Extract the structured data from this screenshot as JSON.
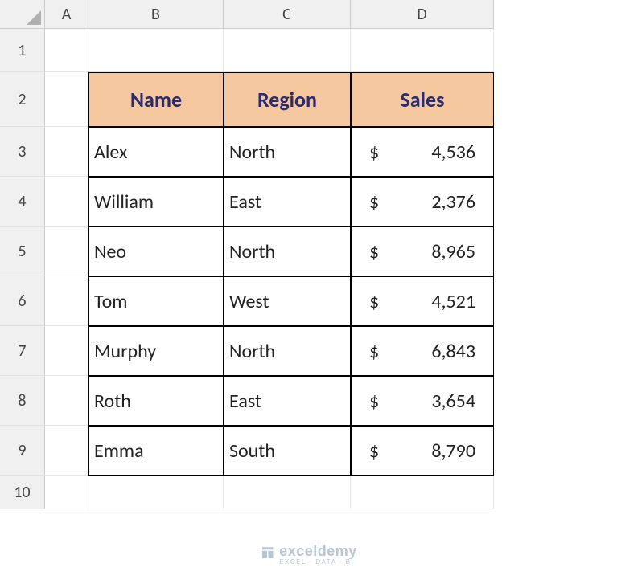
{
  "columns": [
    "A",
    "B",
    "C",
    "D"
  ],
  "rows": [
    "1",
    "2",
    "3",
    "4",
    "5",
    "6",
    "7",
    "8",
    "9",
    "10"
  ],
  "table": {
    "headers": {
      "name": "Name",
      "region": "Region",
      "sales": "Sales"
    },
    "data": [
      {
        "name": "Alex",
        "region": "North",
        "sales_currency": "$",
        "sales_amount": "4,536"
      },
      {
        "name": "William",
        "region": "East",
        "sales_currency": "$",
        "sales_amount": "2,376"
      },
      {
        "name": "Neo",
        "region": "North",
        "sales_currency": "$",
        "sales_amount": "8,965"
      },
      {
        "name": "Tom",
        "region": "West",
        "sales_currency": "$",
        "sales_amount": "4,521"
      },
      {
        "name": "Murphy",
        "region": "North",
        "sales_currency": "$",
        "sales_amount": "6,843"
      },
      {
        "name": "Roth",
        "region": "East",
        "sales_currency": "$",
        "sales_amount": "3,654"
      },
      {
        "name": "Emma",
        "region": "South",
        "sales_currency": "$",
        "sales_amount": "8,790"
      }
    ]
  },
  "watermark": {
    "main": "exceldemy",
    "sub": "EXCEL · DATA · BI"
  },
  "chart_data": {
    "type": "table",
    "columns": [
      "Name",
      "Region",
      "Sales"
    ],
    "rows": [
      [
        "Alex",
        "North",
        4536
      ],
      [
        "William",
        "East",
        2376
      ],
      [
        "Neo",
        "North",
        8965
      ],
      [
        "Tom",
        "West",
        4521
      ],
      [
        "Murphy",
        "North",
        6843
      ],
      [
        "Roth",
        "East",
        3654
      ],
      [
        "Emma",
        "South",
        8790
      ]
    ]
  }
}
